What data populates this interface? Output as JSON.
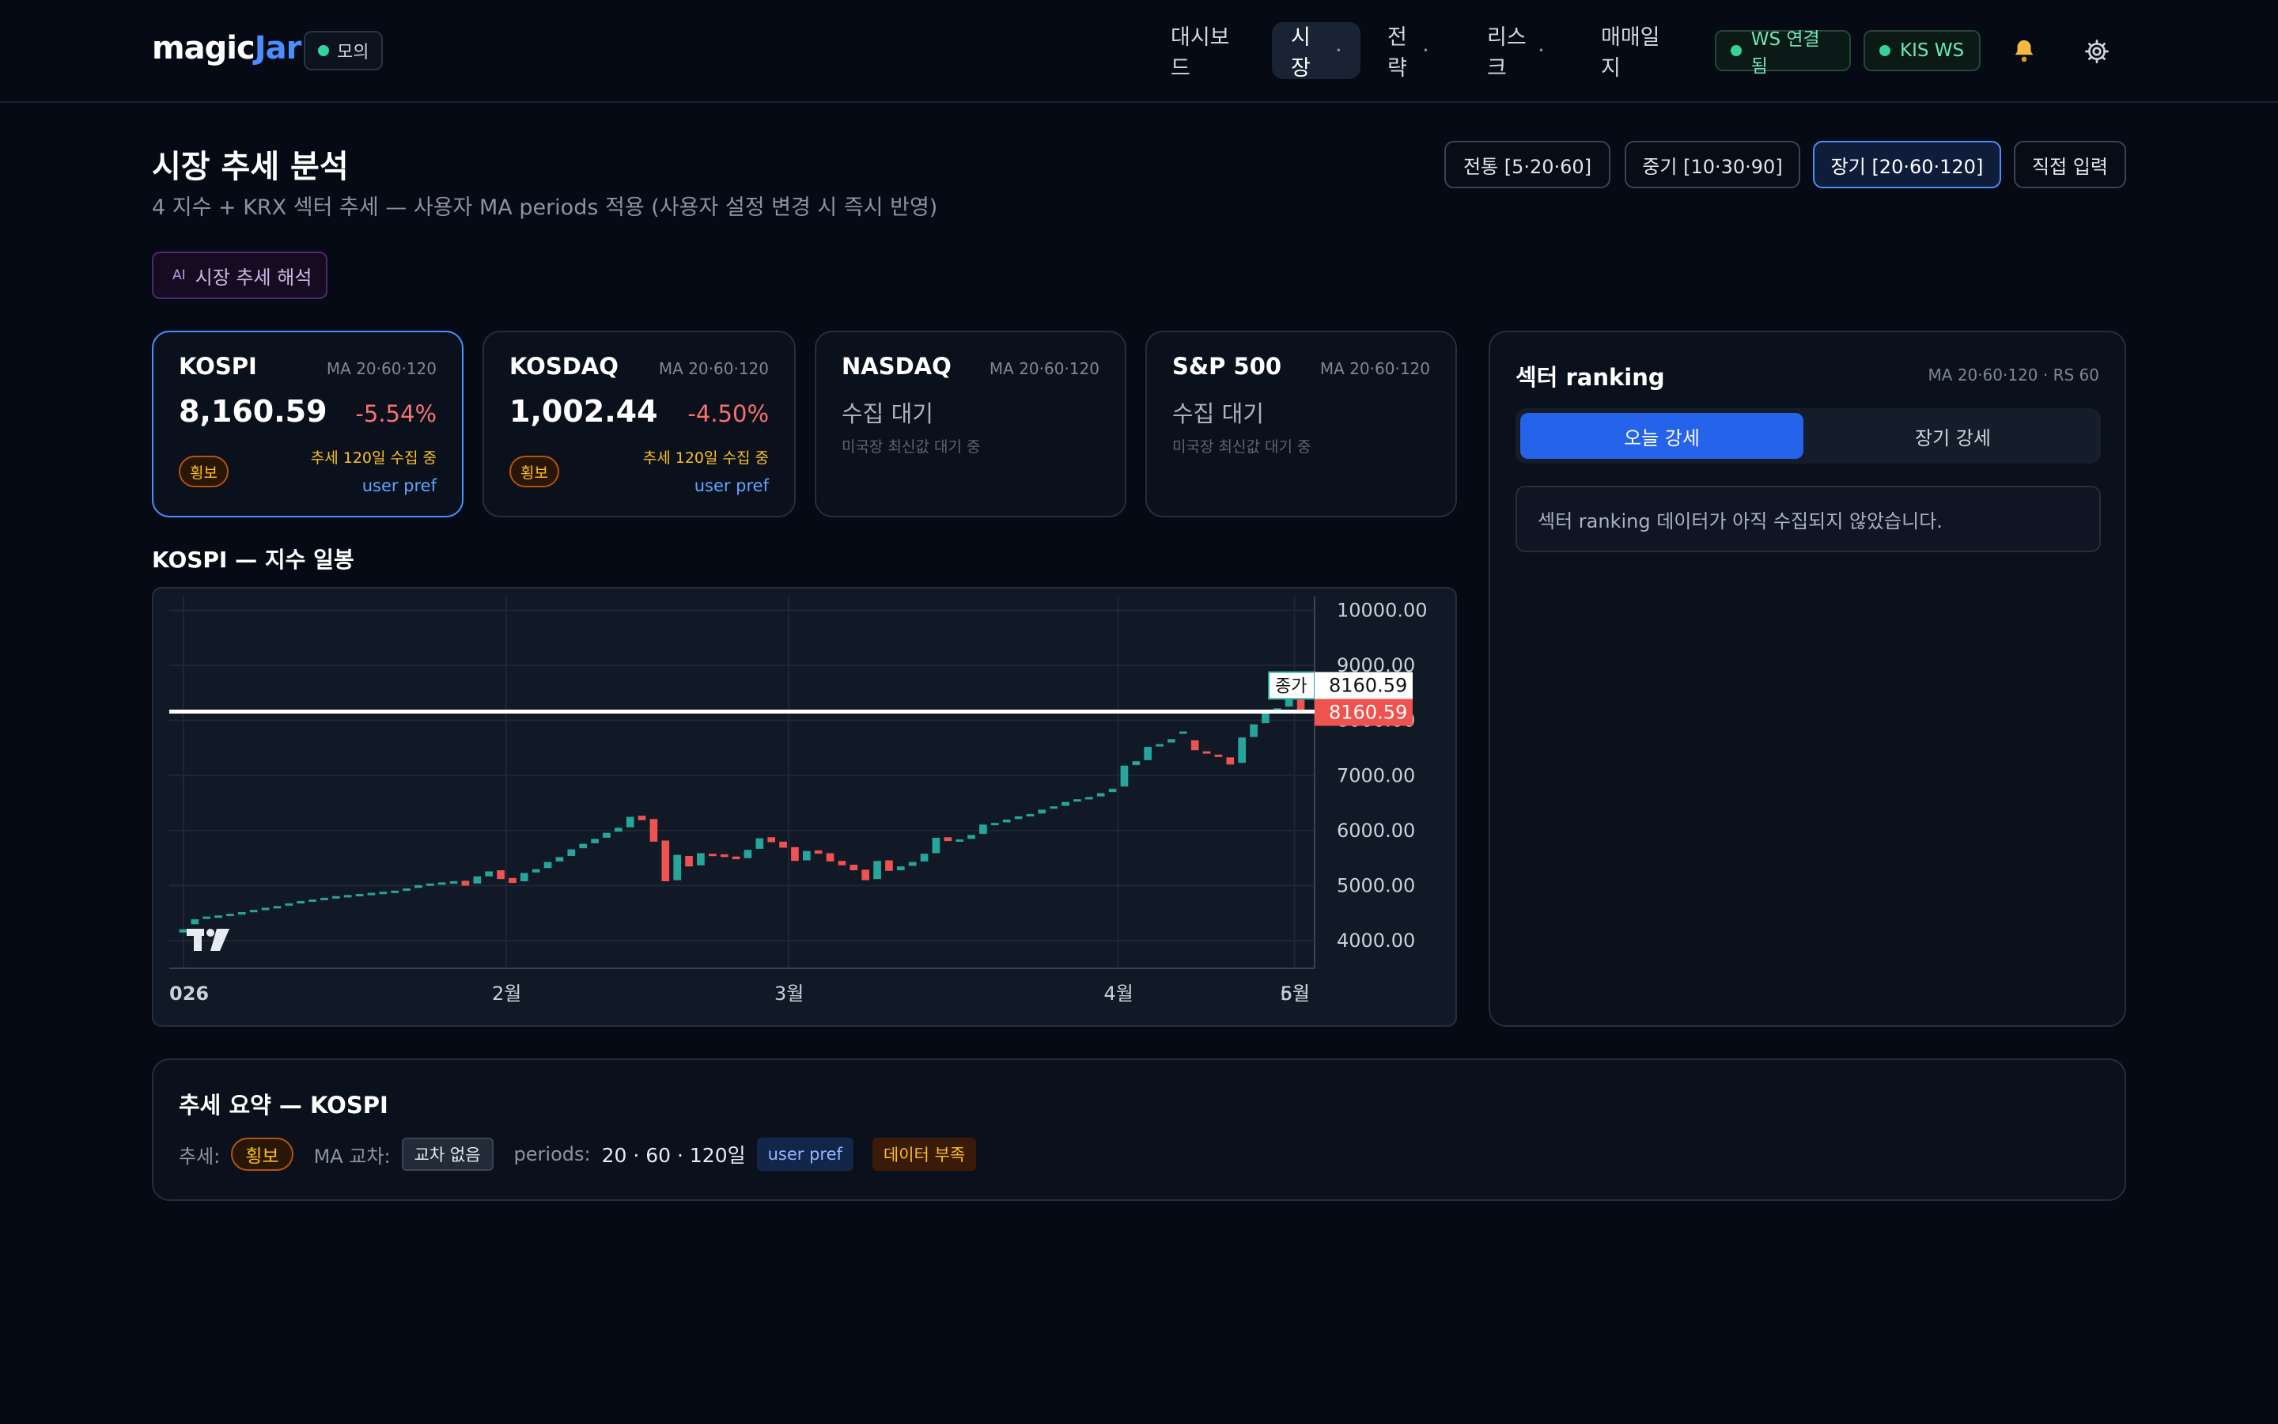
{
  "app": {
    "logo_a": "magic",
    "logo_b": "Jar",
    "mode": "모의"
  },
  "nav": [
    {
      "label": "대시보드",
      "caret": ""
    },
    {
      "label": "시장",
      "caret": "•"
    },
    {
      "label": "전략",
      "caret": "•"
    },
    {
      "label": "리스크",
      "caret": "•"
    },
    {
      "label": "매매일지",
      "caret": ""
    }
  ],
  "status": {
    "ws": "WS 연결됨",
    "kis": "KIS WS"
  },
  "icons": {
    "bell": "bell-icon",
    "settings": "gear-icon"
  },
  "page": {
    "title": "시장 추세 분석",
    "subtitle": "4 지수 + KRX 섹터 추세 — 사용자 MA periods 적용 (사용자 설정 변경 시 즉시 반영)",
    "ai_tag": "AI",
    "ai_label": "시장 추세 해석"
  },
  "presets": [
    "전통 [5·20·60]",
    "중기 [10·30·90]",
    "장기 [20·60·120]",
    "직접 입력"
  ],
  "cards": [
    {
      "name": "KOSPI",
      "ma": "MA 20·60·120",
      "value": "8,160.59",
      "change": "-5.54%",
      "trend": "횡보",
      "note": "추세 120일 수집 중",
      "pref": "user pref"
    },
    {
      "name": "KOSDAQ",
      "ma": "MA 20·60·120",
      "value": "1,002.44",
      "change": "-4.50%",
      "trend": "횡보",
      "note": "추세 120일 수집 중",
      "pref": "user pref"
    },
    {
      "name": "NASDAQ",
      "ma": "MA 20·60·120",
      "wait": "수집 대기",
      "wait_sub": "미국장 최신값 대기 중"
    },
    {
      "name": "S&P 500",
      "ma": "MA 20·60·120",
      "wait": "수집 대기",
      "wait_sub": "미국장 최신값 대기 중"
    }
  ],
  "chart_title": "KOSPI — 지수 일봉",
  "chart_data": {
    "type": "candlestick",
    "title": "KOSPI — 지수 일봉",
    "y_ticks": [
      "10000.00",
      "9000.00",
      "8000.00",
      "7000.00",
      "6000.00",
      "5000.00",
      "4000.00"
    ],
    "ylim": [
      3500,
      10250
    ],
    "x_ticks": [
      "026",
      "2월",
      "3월",
      "4월",
      "5월",
      "6월"
    ],
    "close_label": "종가",
    "close_value": "8160.59",
    "price_line": "8160.59",
    "closes": [
      4210,
      4390,
      4440,
      4460,
      4490,
      4520,
      4560,
      4600,
      4630,
      4680,
      4720,
      4750,
      4780,
      4810,
      4830,
      4850,
      4870,
      4890,
      4910,
      4950,
      5010,
      5040,
      5060,
      5080,
      5000,
      5170,
      5260,
      5120,
      5050,
      5230,
      5300,
      5430,
      5520,
      5660,
      5760,
      5850,
      5960,
      6050,
      6250,
      6190,
      5800,
      5080,
      5560,
      5350,
      5590,
      5560,
      5520,
      5480,
      5650,
      5860,
      5790,
      5690,
      5450,
      5630,
      5580,
      5440,
      5370,
      5280,
      5100,
      5450,
      5270,
      5350,
      5430,
      5580,
      5870,
      5810,
      5840,
      5920,
      6110,
      6140,
      6200,
      6260,
      6300,
      6380,
      6440,
      6520,
      6570,
      6610,
      6680,
      6760,
      7180,
      7260,
      7520,
      7570,
      7660,
      7800,
      7460,
      7400,
      7350,
      7200,
      7690,
      7930,
      8140,
      8220,
      8660,
      8160
    ],
    "opens": [
      4150,
      4300,
      4400,
      4450,
      4470,
      4500,
      4530,
      4570,
      4610,
      4640,
      4690,
      4730,
      4760,
      4790,
      4810,
      4830,
      4850,
      4880,
      4890,
      4920,
      4960,
      5000,
      5050,
      5070,
      5090,
      5040,
      5170,
      5280,
      5140,
      5080,
      5240,
      5320,
      5440,
      5540,
      5680,
      5770,
      5870,
      5980,
      6060,
      6270,
      6210,
      5820,
      5100,
      5540,
      5370,
      5580,
      5570,
      5530,
      5500,
      5670,
      5880,
      5800,
      5700,
      5460,
      5640,
      5590,
      5450,
      5380,
      5290,
      5120,
      5460,
      5280,
      5360,
      5440,
      5590,
      5880,
      5820,
      5850,
      5940,
      6120,
      6150,
      6210,
      6270,
      6310,
      6400,
      6450,
      6530,
      6580,
      6620,
      6700,
      6800,
      7190,
      7280,
      7530,
      7600,
      7800,
      7640,
      7440,
      7380,
      7330,
      7230,
      7700,
      7950,
      8160,
      8250,
      8680
    ]
  },
  "sector": {
    "title": "섹터 ranking",
    "meta": "MA 20·60·120 · RS 60",
    "tabs": [
      "오늘 강세",
      "장기 강세"
    ],
    "empty": "섹터 ranking 데이터가 아직 수집되지 않았습니다."
  },
  "summary": {
    "title": "추세 요약 — KOSPI",
    "trend_label": "추세:",
    "trend_value": "횡보",
    "cross_label": "MA 교차:",
    "cross_value": "교차 없음",
    "periods_label": "periods:",
    "periods_value": "20 · 60 · 120일",
    "pref_tag": "user pref",
    "lack_tag": "데이터 부족"
  },
  "colors": {
    "up": "#26a69a",
    "down": "#ef5350",
    "accent": "#4d8dff",
    "bg": "#050a14"
  }
}
